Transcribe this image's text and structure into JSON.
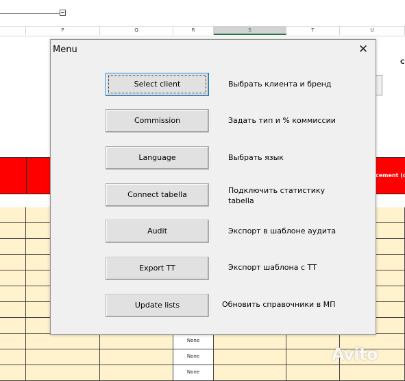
{
  "sheet": {
    "columns": [
      "P",
      "Q",
      "R",
      "S",
      "T",
      "U"
    ],
    "selected_column": "S",
    "red_header_text": "cement (d",
    "right_letter": "C",
    "none_label": "None"
  },
  "dialog": {
    "title": "Menu",
    "close_symbol": "✕",
    "items": [
      {
        "label": "Select client",
        "description": "Выбрать клиента и бренд"
      },
      {
        "label": "Commission",
        "description": "Задать тип и % коммиссии"
      },
      {
        "label": "Language",
        "description": "Выбрать язык"
      },
      {
        "label": "Connect tabella",
        "description": "Подключить статистику tabella"
      },
      {
        "label": "Audit",
        "description": "Экспорт в шаблоне аудита"
      },
      {
        "label": "Export TT",
        "description": "Экспорт шаблона с ТТ"
      },
      {
        "label": "Update lists",
        "description": "Обновить справочники в МП"
      }
    ]
  },
  "watermark": {
    "text": "Avito"
  },
  "colors": {
    "header_red": "#ff0000",
    "cell_cream": "#fff2cc",
    "dialog_bg": "#f0f0f0",
    "button_bg": "#e1e1e1"
  }
}
